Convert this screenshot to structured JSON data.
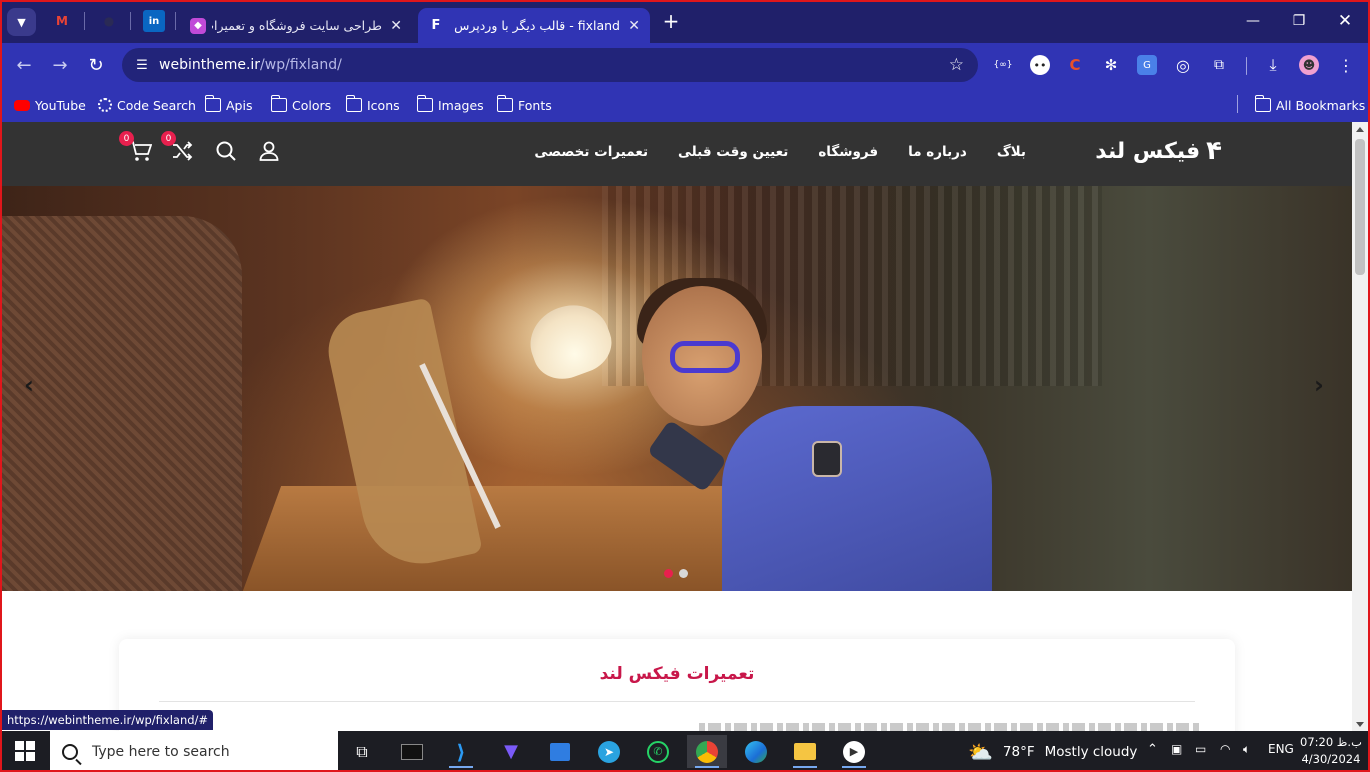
{
  "browser": {
    "tabs": [
      {
        "title": "طراحی سایت فروشگاه و تعمیرات",
        "active": false
      },
      {
        "title": "fixland - قالب دیگر با وردپرس فارسی",
        "active": true
      }
    ],
    "url_host": "webintheme.ir",
    "url_path": "/wp/fixland/",
    "bookmarks": [
      "YouTube",
      "Code Search",
      "Apis",
      "Colors",
      "Icons",
      "Images",
      "Fonts"
    ],
    "all_bookmarks": "All Bookmarks",
    "status_url": "https://webintheme.ir/wp/fixland/#"
  },
  "site": {
    "logo": "فیکس لند",
    "nav": [
      "تعمیرات تخصصی",
      "تعیین وقت قبلی",
      "فروشگاه",
      "درباره ما",
      "بلاگ"
    ],
    "cart_count": "0",
    "compare_count": "0",
    "slider": {
      "slides": 2,
      "active_slide": 1
    },
    "section_title": "تعمیرات فیکس لند"
  },
  "taskbar": {
    "search_placeholder": "Type here to search",
    "weather_temp": "78°F",
    "weather_desc": "Mostly cloudy",
    "lang": "ENG",
    "time": "07:20 ب.ظ",
    "date": "4/30/2024"
  },
  "colors": {
    "tabstrip": "#20206a",
    "toolbar": "#3034b4",
    "site_header": "#333333",
    "accent": "#e8204e",
    "title_red": "#c8174a"
  }
}
